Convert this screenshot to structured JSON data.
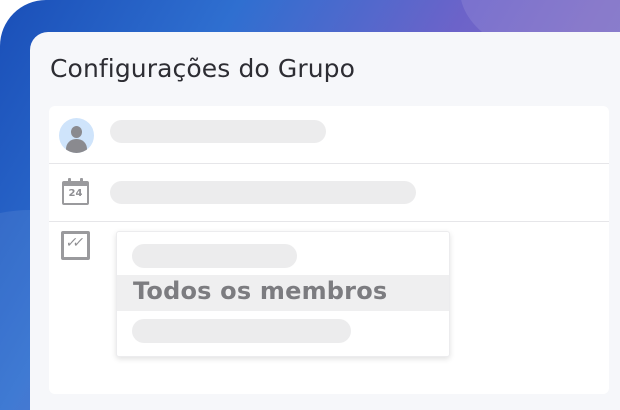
{
  "title": "Configurações do Grupo",
  "rows": [
    {
      "icon": "user-avatar-icon"
    },
    {
      "icon": "calendar-icon",
      "calendar_day": "24"
    },
    {
      "icon": "checklist-icon"
    }
  ],
  "dropdown": {
    "selected_option": "Todos os membros"
  },
  "colors": {
    "accent_gradient_start": "#1a4fb8",
    "accent_gradient_end": "#7c6bc6",
    "panel_bg": "#f6f7fa",
    "placeholder": "#ececed"
  }
}
